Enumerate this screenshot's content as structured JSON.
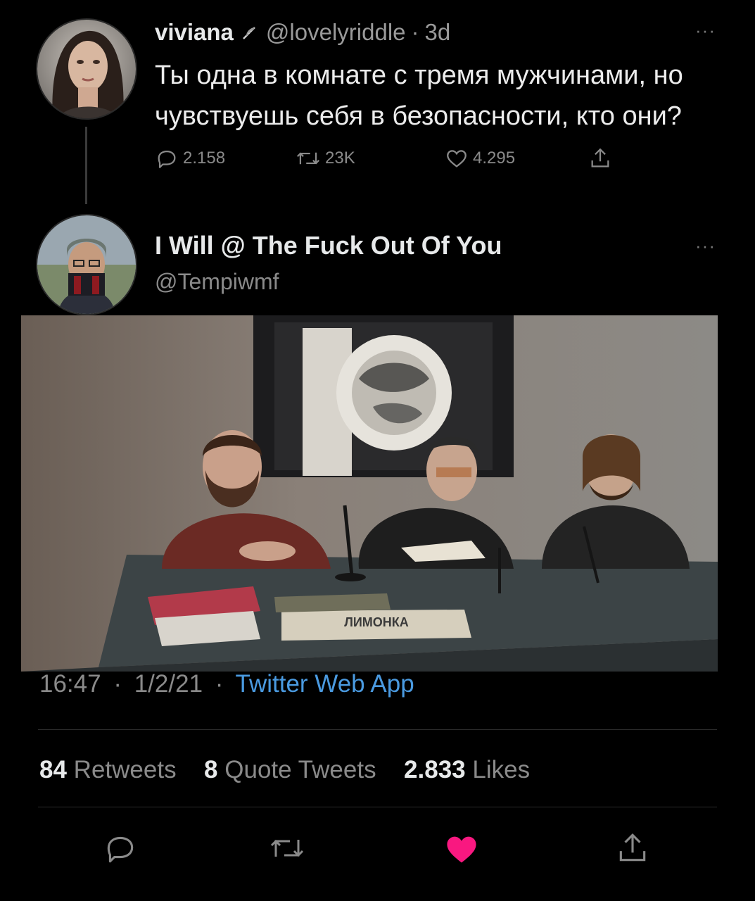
{
  "tweet1": {
    "name": "viviana",
    "name_icon": "feather-emoji-icon",
    "handle": "@lovelyriddle",
    "separator": "·",
    "age": "3d",
    "more": "···",
    "text": "Ты одна в комнате с тремя мужчинами, но чувствуешь себя в безопасности, кто они?",
    "replies": "2.158",
    "retweets": "23K",
    "likes": "4.295"
  },
  "tweet2": {
    "name": "I Will @ The Fuck Out Of You",
    "handle": "@Tempiwmf",
    "more": "···",
    "media": {
      "sign_text": "ЛИМОНКА",
      "newspaper_text": "ЛИМОНКА"
    },
    "time": "16:47",
    "date": "1/2/21",
    "separator": "·",
    "app": "Twitter Web App",
    "stats": {
      "retweets_count": "84",
      "retweets_label": "Retweets",
      "quotes_count": "8",
      "quotes_label": "Quote Tweets",
      "likes_count": "2.833",
      "likes_label": "Likes"
    },
    "liked": true,
    "like_color": "#f91880"
  }
}
